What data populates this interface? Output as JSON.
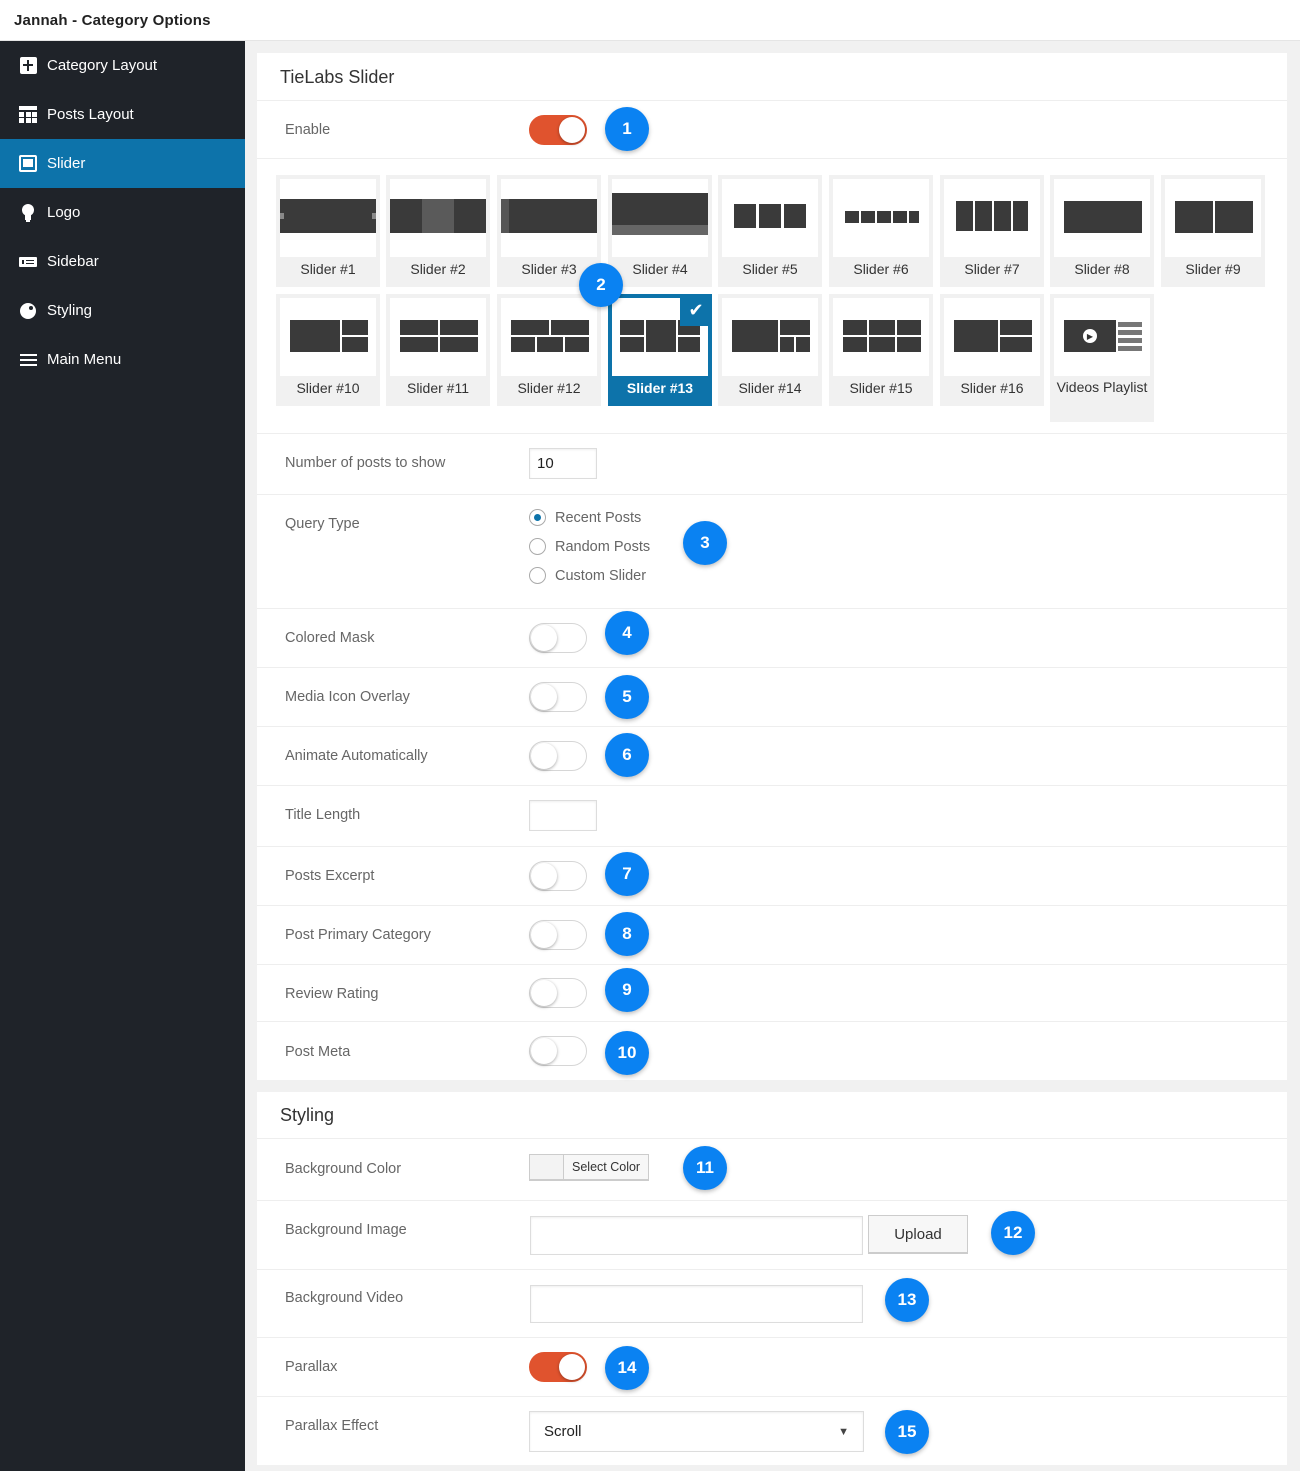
{
  "window": {
    "title": "Jannah - Category Options"
  },
  "sidebar": {
    "items": [
      {
        "label": "Category Layout",
        "icon": "category-layout-icon"
      },
      {
        "label": "Posts Layout",
        "icon": "posts-layout-icon"
      },
      {
        "label": "Slider",
        "icon": "slider-icon",
        "active": true
      },
      {
        "label": "Logo",
        "icon": "lightbulb-icon"
      },
      {
        "label": "Sidebar",
        "icon": "sidebar-icon"
      },
      {
        "label": "Styling",
        "icon": "palette-icon"
      },
      {
        "label": "Main Menu",
        "icon": "menu-icon"
      }
    ]
  },
  "slider_section": {
    "title": "TieLabs Slider",
    "enable": {
      "label": "Enable",
      "on": true,
      "badge": "1"
    },
    "tiles_row1": [
      "Slider #1",
      "Slider #2",
      "Slider #3",
      "Slider #4",
      "Slider #5",
      "Slider #6",
      "Slider #7",
      "Slider #8",
      "Slider #9"
    ],
    "tiles_row2": [
      "Slider #10",
      "Slider #11",
      "Slider #12",
      "Slider #13",
      "Slider #14",
      "Slider #15",
      "Slider #16",
      "Videos Playlist"
    ],
    "selected_tile": "Slider #13",
    "tiles_badge": "2",
    "num_posts": {
      "label": "Number of posts to show",
      "value": "10"
    },
    "query_type": {
      "label": "Query Type",
      "options": [
        "Recent Posts",
        "Random Posts",
        "Custom Slider"
      ],
      "selected": "Recent Posts",
      "badge": "3"
    },
    "colored_mask": {
      "label": "Colored Mask",
      "on": false,
      "badge": "4"
    },
    "media_icon_overlay": {
      "label": "Media Icon Overlay",
      "on": false,
      "badge": "5"
    },
    "animate_automatically": {
      "label": "Animate Automatically",
      "on": false,
      "badge": "6"
    },
    "title_length": {
      "label": "Title Length",
      "value": ""
    },
    "posts_excerpt": {
      "label": "Posts Excerpt",
      "on": false,
      "badge": "7"
    },
    "post_primary_category": {
      "label": "Post Primary Category",
      "on": false,
      "badge": "8"
    },
    "review_rating": {
      "label": "Review Rating",
      "on": false,
      "badge": "9"
    },
    "post_meta": {
      "label": "Post Meta",
      "on": false,
      "badge": "10"
    }
  },
  "styling_section": {
    "title": "Styling",
    "bg_color": {
      "label": "Background Color",
      "button": "Select Color",
      "badge": "11"
    },
    "bg_image": {
      "label": "Background Image",
      "value": "",
      "button": "Upload",
      "badge": "12"
    },
    "bg_video": {
      "label": "Background Video",
      "value": "",
      "badge": "13"
    },
    "parallax": {
      "label": "Parallax",
      "on": true,
      "badge": "14"
    },
    "parallax_effect": {
      "label": "Parallax Effect",
      "value": "Scroll",
      "badge": "15"
    }
  },
  "colors": {
    "accent": "#0d73aa",
    "toggle_on": "#e0532e",
    "badge": "#0a82f2",
    "sidebar_bg": "#1f2329"
  }
}
